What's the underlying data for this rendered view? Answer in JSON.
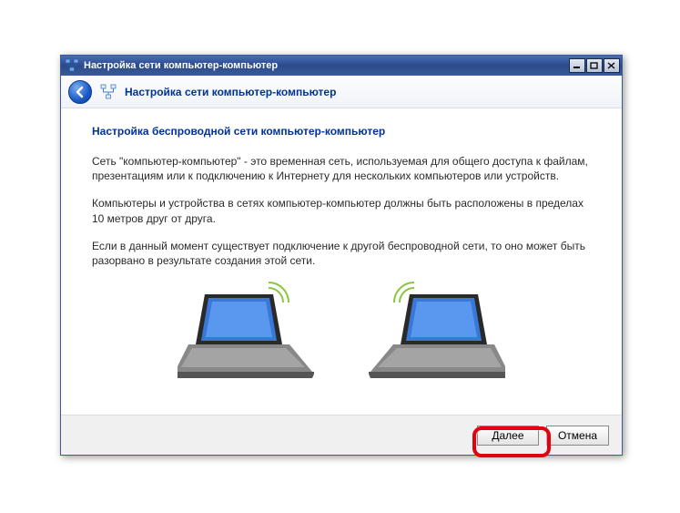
{
  "titlebar": {
    "title": "Настройка сети компьютер-компьютер"
  },
  "header": {
    "title": "Настройка сети компьютер-компьютер"
  },
  "content": {
    "heading": "Настройка беспроводной сети компьютер-компьютер",
    "para1": "Сеть \"компьютер-компьютер\" - это временная сеть, используемая для общего доступа к файлам, презентациям или к подключению к Интернету для нескольких компьютеров или устройств.",
    "para2": "Компьютеры и устройства в сетях компьютер-компьютер должны быть расположены в пределах 10 метров друг от друга.",
    "para3": "Если в данный момент существует подключение к другой беспроводной сети, то оно может быть разорвано в результате создания этой сети."
  },
  "footer": {
    "next_label": "Далее",
    "cancel_label": "Отмена"
  }
}
